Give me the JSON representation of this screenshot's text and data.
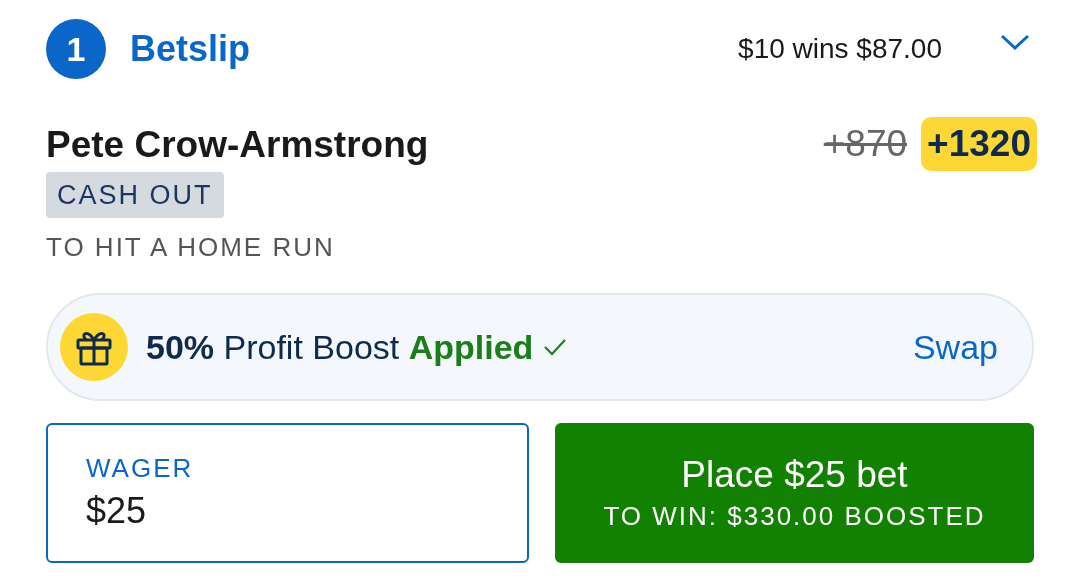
{
  "header": {
    "count": "1",
    "title": "Betslip",
    "summary": "$10 wins $87.00"
  },
  "selection": {
    "name": "Pete Crow-Armstrong",
    "original_odds": "+870",
    "boosted_odds": "+1320",
    "tag": "CASH OUT",
    "market": "TO HIT A HOME RUN"
  },
  "boost": {
    "amount": "50%",
    "label": "Profit Boost",
    "status": "Applied",
    "action": "Swap"
  },
  "wager": {
    "label": "WAGER",
    "value": "$25"
  },
  "place_button": {
    "label": "Place $25 bet",
    "sublabel": "TO WIN: $330.00 BOOSTED"
  }
}
